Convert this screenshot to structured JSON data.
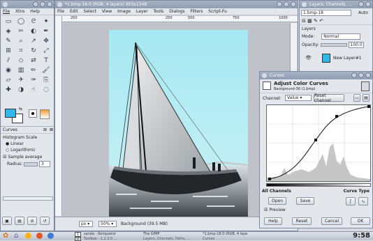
{
  "toolbox": {
    "title": "",
    "menu": [
      "File",
      "Xtns",
      "Help"
    ],
    "tool_icons": [
      "rect-select-icon",
      "ellipse-select-icon",
      "free-select-icon",
      "fuzzy-select-icon",
      "color-select-icon",
      "scissors-icon",
      "foreground-select-icon",
      "paths-icon",
      "color-picker-icon",
      "zoom-icon",
      "measure-icon",
      "move-icon",
      "align-icon",
      "crop-icon",
      "rotate-icon",
      "scale-icon",
      "shear-icon",
      "perspective-icon",
      "flip-icon",
      "text-icon",
      "bucket-fill-icon",
      "blend-icon",
      "pencil-icon",
      "paintbrush-icon",
      "eraser-icon",
      "airbrush-icon",
      "ink-icon",
      "clone-icon",
      "heal-icon",
      "dodge-icon",
      "smudge-icon",
      "blur-icon"
    ],
    "fg_color": "#31b8e8",
    "bg_color": "#ffffff",
    "tab_label": "Curves",
    "histogram_scale_label": "Histogram Scale",
    "linear_label": "Linear",
    "log_label": "Logarithmic",
    "sample_average_label": "Sample average",
    "radius_label": "Radius:",
    "radius_value": "3"
  },
  "image_window": {
    "title": "*1.bmp-18.0 (RGB, 4 layers) 903x1348",
    "menu": [
      "File",
      "Edit",
      "Select",
      "View",
      "Image",
      "Layer",
      "Tools",
      "Dialogs",
      "Filters",
      "Script-Fu"
    ],
    "ruler_labels": [
      "250",
      "250",
      "500",
      "750",
      "1000"
    ],
    "unit": "px",
    "zoom": "50%",
    "status": "Background (39.5 MB)"
  },
  "layers_window": {
    "title": "Layers, Channels, ...",
    "image_select": "1.bmp-18",
    "auto_label": "Auto",
    "section_title": "Layers",
    "mode_label": "Mode:",
    "mode_value": "Normal",
    "opacity_label": "Opacity:",
    "opacity_value": "100.0",
    "layer_name": "New Layer#1"
  },
  "curves_dialog": {
    "title": "Curves",
    "heading": "Adjust Color Curves",
    "subheading": "Background-36 (1.bmp)",
    "channel_label": "Channel:",
    "channel_value": "Value",
    "reset_channel": "Reset channel",
    "all_channels": "All Channels",
    "curve_type": "Curve Type",
    "open": "Open",
    "save": "Save",
    "preview": "Preview",
    "help": "Help",
    "reset": "Reset",
    "cancel": "Cancel",
    "ok": "OK"
  },
  "taskbar": {
    "tasks": [
      {
        "label": "sarala - Konqueror"
      },
      {
        "label": "The GIMP"
      },
      {
        "label": "*1.bmp-18.0 (RGB, 4 laye"
      },
      {
        "label": "Toolbox - 1.2.3.0 ..."
      },
      {
        "label": "Layers, Channels, Paths, ..."
      },
      {
        "label": "Curves"
      }
    ],
    "pager": [
      "1",
      "2"
    ],
    "clock": "9:58"
  }
}
